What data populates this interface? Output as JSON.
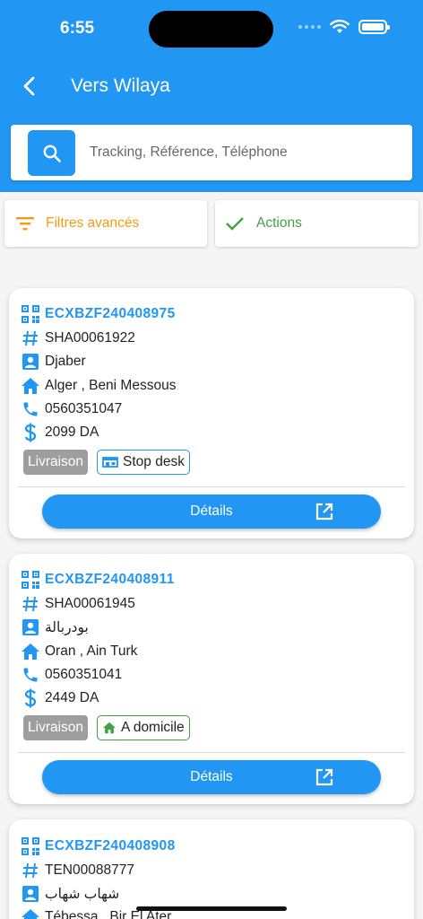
{
  "status_bar": {
    "time": "6:55"
  },
  "header": {
    "title": "Vers Wilaya"
  },
  "search": {
    "placeholder": "Tracking, Référence, Téléphone"
  },
  "toolbar": {
    "filters_label": "Filtres avancés",
    "actions_label": "Actions"
  },
  "colors": {
    "primary": "#2196f3",
    "filters": "#f39c12",
    "actions": "#43a047",
    "type_badge": "#9e9e9e"
  },
  "orders": [
    {
      "tracking": "ECXBZF240408975",
      "reference": "SHA00061922",
      "customer": "Djaber",
      "location": "Alger , Beni Messous",
      "phone": "0560351047",
      "amount": "2099 DA",
      "type": "Livraison",
      "delivery_mode": "Stop desk",
      "delivery_icon": "store-icon",
      "details_label": "Détails"
    },
    {
      "tracking": "ECXBZF240408911",
      "reference": "SHA00061945",
      "customer": "بودربالة",
      "location": "Oran , Ain Turk",
      "phone": "0560351041",
      "amount": "2449 DA",
      "type": "Livraison",
      "delivery_mode": "A domicile",
      "delivery_icon": "home-icon",
      "details_label": "Détails"
    },
    {
      "tracking": "ECXBZF240408908",
      "reference": "TEN00088777",
      "customer": "شهاب شهاب",
      "location": "Tébessa , Bir El Ater"
    }
  ]
}
